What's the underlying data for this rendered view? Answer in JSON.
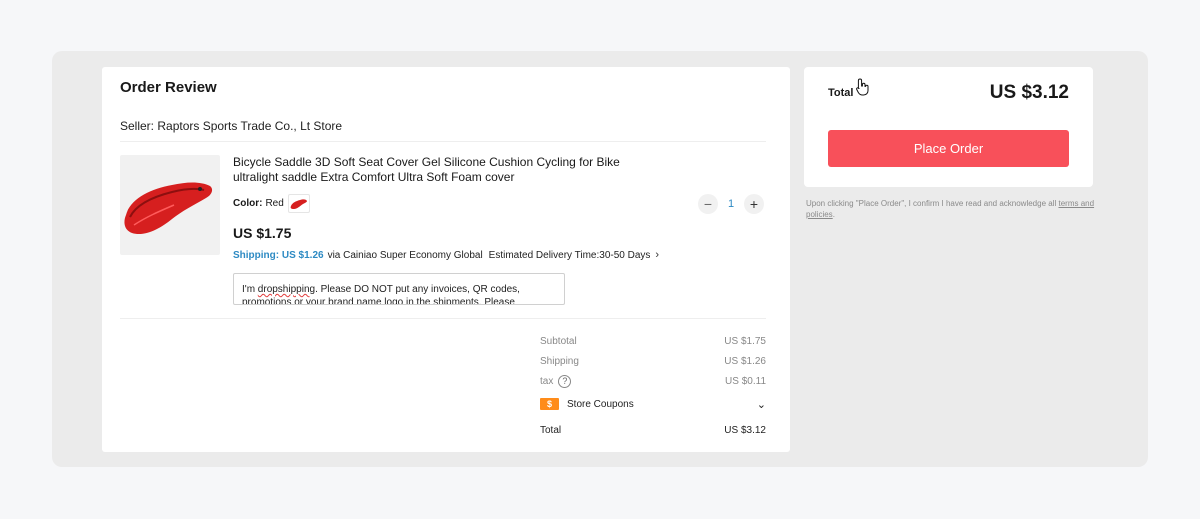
{
  "order_review": {
    "title": "Order Review",
    "seller": "Seller: Raptors Sports Trade Co., Lt Store",
    "product": {
      "name": "Bicycle Saddle 3D Soft Seat Cover Gel Silicone Cushion Cycling for Bike ultralight saddle Extra Comfort Ultra Soft Foam cover",
      "color_label": "Color:",
      "color_value": "Red",
      "price": "US $1.75",
      "shipping_label": "Shipping: US $1.26",
      "shipping_via": "via Cainiao Super Economy Global",
      "delivery": "Estimated Delivery Time:30-50 Days",
      "quantity": "1",
      "note_prefix": "I'm ",
      "note_misspelled": "dropshipping",
      "note_rest": ". Please DO NOT put any invoices, QR codes, promotions or your brand name logo in the shipments. Please"
    },
    "summary": {
      "subtotal_label": "Subtotal",
      "subtotal_value": "US $1.75",
      "shipping_label": "Shipping",
      "shipping_value": "US $1.26",
      "tax_label": "tax",
      "tax_value": "US $0.11",
      "coupon_badge": "$",
      "coupons_label": "Store Coupons",
      "total_label": "Total",
      "total_value": "US $3.12"
    }
  },
  "checkout": {
    "total_label": "Total",
    "total_value": "US $3.12",
    "place_order_label": "Place Order",
    "disclaimer_text": "Upon clicking \"Place Order\", I confirm I have read and acknowledge all",
    "terms_link": "terms and policies",
    "terms_end": "."
  },
  "colors": {
    "accent_red": "#f8505a",
    "link_blue": "#2d8ac3",
    "coupon_orange": "#ff8c1a"
  },
  "icons": {
    "product_thumbnail": "red-bike-saddle",
    "color_swatch": "red-bike-saddle",
    "quantity_decrease": "minus-icon",
    "quantity_increase": "plus-icon",
    "tax_help": "question-circle-icon",
    "coupon": "coupon-badge-icon",
    "coupons_toggle": "chevron-down-icon",
    "delivery_more": "chevron-right-icon",
    "cursor": "hand-pointer-icon"
  }
}
